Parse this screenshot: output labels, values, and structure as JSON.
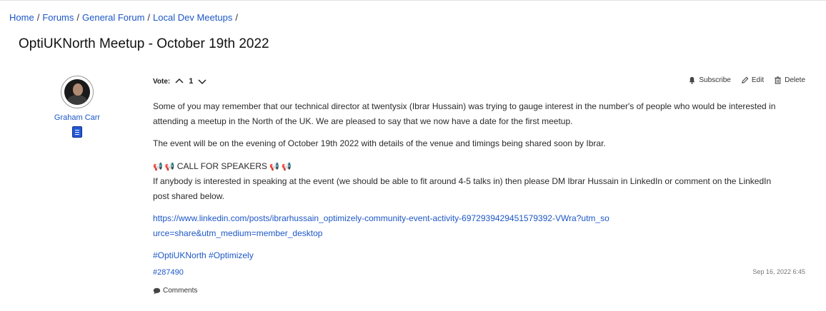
{
  "breadcrumb": {
    "items": [
      "Home",
      "Forums",
      "General Forum",
      "Local Dev Meetups"
    ],
    "separator": "/"
  },
  "page_title": "OptiUKNorth Meetup - October 19th 2022",
  "author": {
    "name": "Graham Carr",
    "avatar_icon": "user-avatar",
    "badge_icon": "badge-icon"
  },
  "vote": {
    "label": "Vote:",
    "count": "1"
  },
  "actions": {
    "subscribe": "Subscribe",
    "edit": "Edit",
    "delete": "Delete"
  },
  "post": {
    "para1": "Some of you may remember that our technical director at twentysix (Ibrar Hussain) was trying to gauge interest in the number's of people who would be interested in attending a meetup in the North of the UK. We are pleased to say that we now have a date for the first meetup.",
    "para2": "The event will be on the evening of October 19th 2022 with details of the venue and timings being shared soon by Ibrar.",
    "call_prefix": "📢 📢",
    "call_text": "CALL FOR SPEAKERS",
    "call_suffix": "📢 📢",
    "para3": "If anybody is interested in speaking at the event (we should be able to fit around 4-5 talks in) then please DM Ibrar Hussain in LinkedIn or comment on the LinkedIn post shared below.",
    "link": "https://www.linkedin.com/posts/ibrarhussain_optimizely-community-event-activity-6972939429451579392-VWra?utm_source=share&utm_medium=member_desktop",
    "hashtags": "#OptiUKNorth #Optimizely"
  },
  "post_id": "#287490",
  "post_date": "Sep 16, 2022 6:45",
  "comments_label": "Comments",
  "colors": {
    "link": "#1d57c7",
    "text": "#2a2a2a",
    "badge": "#2458d6"
  }
}
